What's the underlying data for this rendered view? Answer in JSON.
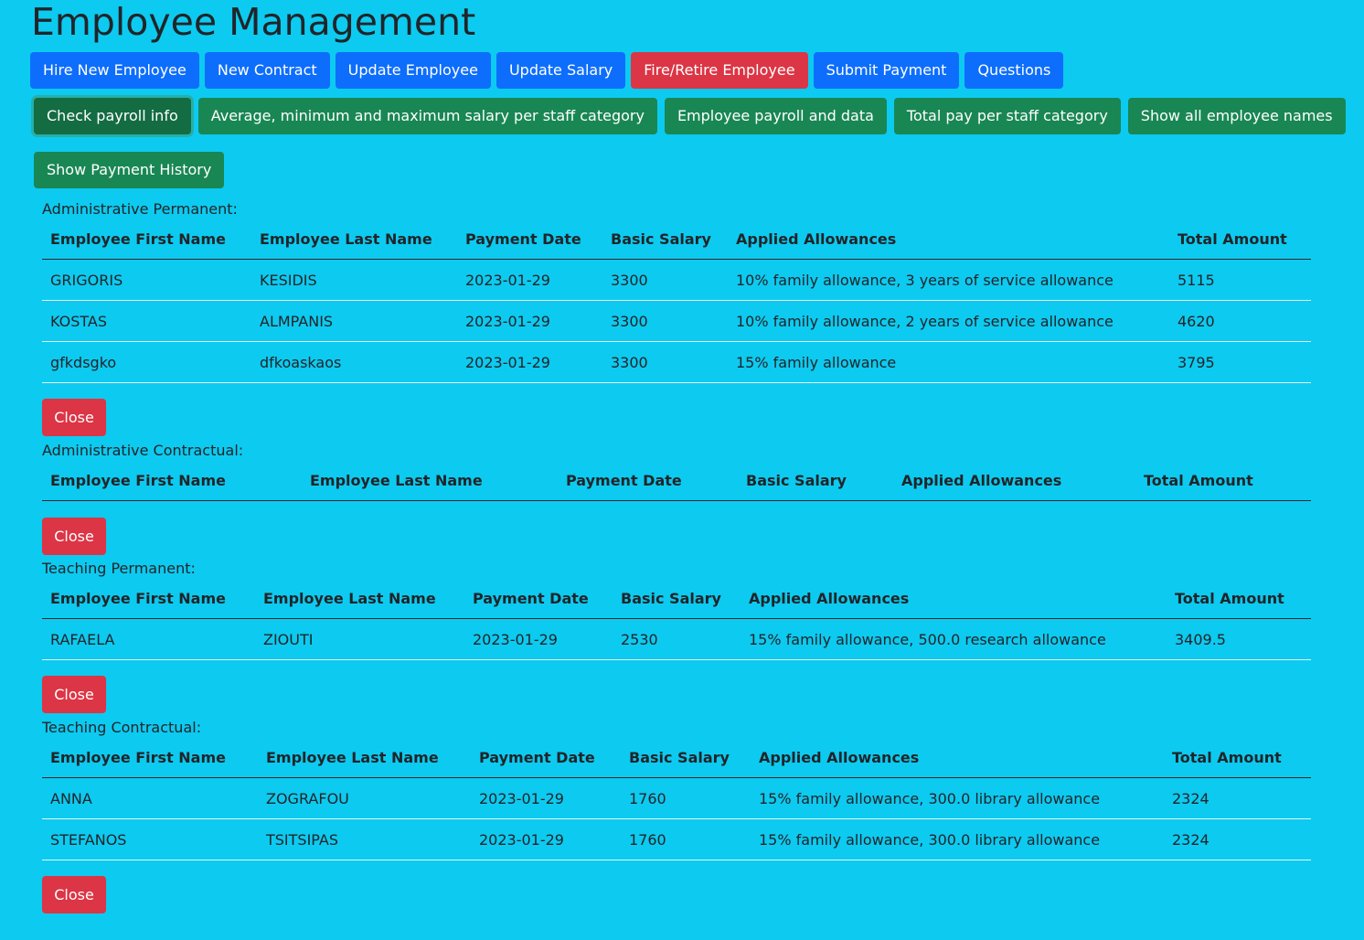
{
  "page": {
    "title": "Employee Management"
  },
  "nav": {
    "row1": [
      {
        "label": "Hire New Employee",
        "style": "primary"
      },
      {
        "label": "New Contract",
        "style": "primary"
      },
      {
        "label": "Update Employee",
        "style": "primary"
      },
      {
        "label": "Update Salary",
        "style": "primary"
      },
      {
        "label": "Fire/Retire Employee",
        "style": "danger"
      },
      {
        "label": "Submit Payment",
        "style": "primary"
      },
      {
        "label": "Questions",
        "style": "primary"
      }
    ],
    "row2": [
      {
        "label": "Check payroll info",
        "active": true
      },
      {
        "label": "Average, minimum and maximum salary per staff category"
      },
      {
        "label": "Employee payroll and data"
      },
      {
        "label": "Total pay per staff category"
      },
      {
        "label": "Show all employee names"
      }
    ],
    "row3": [
      {
        "label": "Show Payment History"
      }
    ]
  },
  "columns": [
    "Employee First Name",
    "Employee Last Name",
    "Payment Date",
    "Basic Salary",
    "Applied Allowances",
    "Total Amount"
  ],
  "close_label": "Close",
  "sections": [
    {
      "label": "Administrative Permanent:",
      "rows": [
        [
          "GRIGORIS",
          "KESIDIS",
          "2023-01-29",
          "3300",
          "10% family allowance, 3 years of service allowance",
          "5115"
        ],
        [
          "KOSTAS",
          "ALMPANIS",
          "2023-01-29",
          "3300",
          "10% family allowance, 2 years of service allowance",
          "4620"
        ],
        [
          "gfkdsgko",
          "dfkoaskaos",
          "2023-01-29",
          "3300",
          "15% family allowance",
          "3795"
        ]
      ]
    },
    {
      "label": "Administrative Contractual:",
      "rows": []
    },
    {
      "label": "Teaching Permanent:",
      "rows": [
        [
          "RAFAELA",
          "ZIOUTI",
          "2023-01-29",
          "2530",
          "15% family allowance, 500.0 research allowance",
          "3409.5"
        ]
      ]
    },
    {
      "label": "Teaching Contractual:",
      "rows": [
        [
          "ANNA",
          "ZOGRAFOU",
          "2023-01-29",
          "1760",
          "15% family allowance, 300.0 library allowance",
          "2324"
        ],
        [
          "STEFANOS",
          "TSITSIPAS",
          "2023-01-29",
          "1760",
          "15% family allowance, 300.0 library allowance",
          "2324"
        ]
      ]
    }
  ],
  "colors": {
    "background": "#0dcaf0",
    "primary": "#0d6efd",
    "danger": "#dc3545",
    "success": "#198754",
    "success_active": "#146c43"
  }
}
